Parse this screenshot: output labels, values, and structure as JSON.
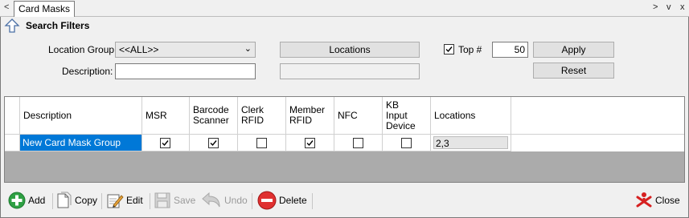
{
  "tab": {
    "prev_glyph": "<",
    "title": "Card Masks",
    "next_glyph": ">",
    "menu_glyph": "v",
    "close_glyph": "x"
  },
  "filters": {
    "title": "Search Filters",
    "icon": "up-arrow-icon",
    "location_group_label": "Location Group",
    "location_group_value": "<<ALL>>",
    "description_label": "Description:",
    "description_value": "",
    "locations_button": "Locations",
    "locations_value": "",
    "top_label": "Top #",
    "top_checked": true,
    "top_value": "50",
    "apply_button": "Apply",
    "reset_button": "Reset"
  },
  "grid": {
    "columns": [
      "Description",
      "MSR",
      "Barcode Scanner",
      "Clerk RFID",
      "Member RFID",
      "NFC",
      "KB Input Device",
      "Locations"
    ],
    "rows": [
      {
        "description": "New Card Mask Group",
        "msr": true,
        "barcode_scanner": true,
        "clerk_rfid": false,
        "member_rfid": true,
        "nfc": false,
        "kb_input_device": false,
        "locations": "2,3"
      }
    ]
  },
  "toolbar": {
    "add": "Add",
    "copy": "Copy",
    "edit": "Edit",
    "save": "Save",
    "undo": "Undo",
    "delete": "Delete",
    "close": "Close"
  },
  "colors": {
    "selection": "#0078d7",
    "grid_background": "#ababab",
    "panel_background": "#f0f0f0",
    "add_icon": "#2ea043",
    "delete_icon": "#e03030",
    "close_icon": "#d62020"
  }
}
